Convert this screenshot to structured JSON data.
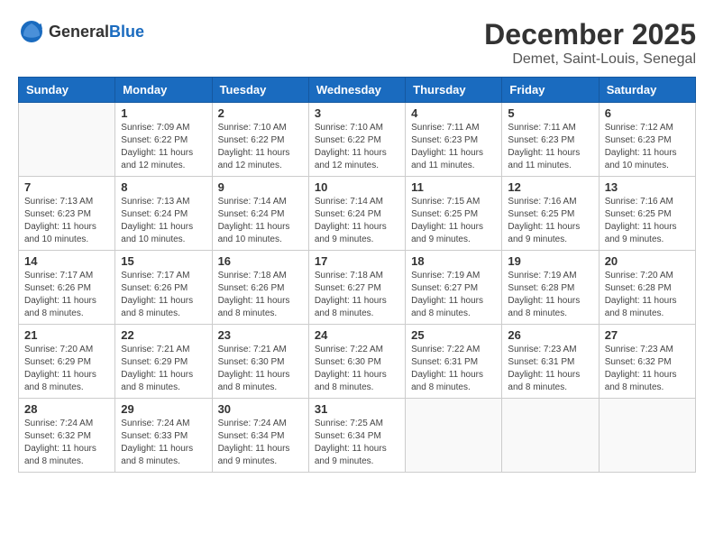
{
  "header": {
    "logo_general": "General",
    "logo_blue": "Blue",
    "month_title": "December 2025",
    "location": "Demet, Saint-Louis, Senegal"
  },
  "days_of_week": [
    "Sunday",
    "Monday",
    "Tuesday",
    "Wednesday",
    "Thursday",
    "Friday",
    "Saturday"
  ],
  "weeks": [
    [
      {
        "day": "",
        "sunrise": "",
        "sunset": "",
        "daylight": ""
      },
      {
        "day": "1",
        "sunrise": "Sunrise: 7:09 AM",
        "sunset": "Sunset: 6:22 PM",
        "daylight": "Daylight: 11 hours and 12 minutes."
      },
      {
        "day": "2",
        "sunrise": "Sunrise: 7:10 AM",
        "sunset": "Sunset: 6:22 PM",
        "daylight": "Daylight: 11 hours and 12 minutes."
      },
      {
        "day": "3",
        "sunrise": "Sunrise: 7:10 AM",
        "sunset": "Sunset: 6:22 PM",
        "daylight": "Daylight: 11 hours and 12 minutes."
      },
      {
        "day": "4",
        "sunrise": "Sunrise: 7:11 AM",
        "sunset": "Sunset: 6:23 PM",
        "daylight": "Daylight: 11 hours and 11 minutes."
      },
      {
        "day": "5",
        "sunrise": "Sunrise: 7:11 AM",
        "sunset": "Sunset: 6:23 PM",
        "daylight": "Daylight: 11 hours and 11 minutes."
      },
      {
        "day": "6",
        "sunrise": "Sunrise: 7:12 AM",
        "sunset": "Sunset: 6:23 PM",
        "daylight": "Daylight: 11 hours and 10 minutes."
      }
    ],
    [
      {
        "day": "7",
        "sunrise": "Sunrise: 7:13 AM",
        "sunset": "Sunset: 6:23 PM",
        "daylight": "Daylight: 11 hours and 10 minutes."
      },
      {
        "day": "8",
        "sunrise": "Sunrise: 7:13 AM",
        "sunset": "Sunset: 6:24 PM",
        "daylight": "Daylight: 11 hours and 10 minutes."
      },
      {
        "day": "9",
        "sunrise": "Sunrise: 7:14 AM",
        "sunset": "Sunset: 6:24 PM",
        "daylight": "Daylight: 11 hours and 10 minutes."
      },
      {
        "day": "10",
        "sunrise": "Sunrise: 7:14 AM",
        "sunset": "Sunset: 6:24 PM",
        "daylight": "Daylight: 11 hours and 9 minutes."
      },
      {
        "day": "11",
        "sunrise": "Sunrise: 7:15 AM",
        "sunset": "Sunset: 6:25 PM",
        "daylight": "Daylight: 11 hours and 9 minutes."
      },
      {
        "day": "12",
        "sunrise": "Sunrise: 7:16 AM",
        "sunset": "Sunset: 6:25 PM",
        "daylight": "Daylight: 11 hours and 9 minutes."
      },
      {
        "day": "13",
        "sunrise": "Sunrise: 7:16 AM",
        "sunset": "Sunset: 6:25 PM",
        "daylight": "Daylight: 11 hours and 9 minutes."
      }
    ],
    [
      {
        "day": "14",
        "sunrise": "Sunrise: 7:17 AM",
        "sunset": "Sunset: 6:26 PM",
        "daylight": "Daylight: 11 hours and 8 minutes."
      },
      {
        "day": "15",
        "sunrise": "Sunrise: 7:17 AM",
        "sunset": "Sunset: 6:26 PM",
        "daylight": "Daylight: 11 hours and 8 minutes."
      },
      {
        "day": "16",
        "sunrise": "Sunrise: 7:18 AM",
        "sunset": "Sunset: 6:26 PM",
        "daylight": "Daylight: 11 hours and 8 minutes."
      },
      {
        "day": "17",
        "sunrise": "Sunrise: 7:18 AM",
        "sunset": "Sunset: 6:27 PM",
        "daylight": "Daylight: 11 hours and 8 minutes."
      },
      {
        "day": "18",
        "sunrise": "Sunrise: 7:19 AM",
        "sunset": "Sunset: 6:27 PM",
        "daylight": "Daylight: 11 hours and 8 minutes."
      },
      {
        "day": "19",
        "sunrise": "Sunrise: 7:19 AM",
        "sunset": "Sunset: 6:28 PM",
        "daylight": "Daylight: 11 hours and 8 minutes."
      },
      {
        "day": "20",
        "sunrise": "Sunrise: 7:20 AM",
        "sunset": "Sunset: 6:28 PM",
        "daylight": "Daylight: 11 hours and 8 minutes."
      }
    ],
    [
      {
        "day": "21",
        "sunrise": "Sunrise: 7:20 AM",
        "sunset": "Sunset: 6:29 PM",
        "daylight": "Daylight: 11 hours and 8 minutes."
      },
      {
        "day": "22",
        "sunrise": "Sunrise: 7:21 AM",
        "sunset": "Sunset: 6:29 PM",
        "daylight": "Daylight: 11 hours and 8 minutes."
      },
      {
        "day": "23",
        "sunrise": "Sunrise: 7:21 AM",
        "sunset": "Sunset: 6:30 PM",
        "daylight": "Daylight: 11 hours and 8 minutes."
      },
      {
        "day": "24",
        "sunrise": "Sunrise: 7:22 AM",
        "sunset": "Sunset: 6:30 PM",
        "daylight": "Daylight: 11 hours and 8 minutes."
      },
      {
        "day": "25",
        "sunrise": "Sunrise: 7:22 AM",
        "sunset": "Sunset: 6:31 PM",
        "daylight": "Daylight: 11 hours and 8 minutes."
      },
      {
        "day": "26",
        "sunrise": "Sunrise: 7:23 AM",
        "sunset": "Sunset: 6:31 PM",
        "daylight": "Daylight: 11 hours and 8 minutes."
      },
      {
        "day": "27",
        "sunrise": "Sunrise: 7:23 AM",
        "sunset": "Sunset: 6:32 PM",
        "daylight": "Daylight: 11 hours and 8 minutes."
      }
    ],
    [
      {
        "day": "28",
        "sunrise": "Sunrise: 7:24 AM",
        "sunset": "Sunset: 6:32 PM",
        "daylight": "Daylight: 11 hours and 8 minutes."
      },
      {
        "day": "29",
        "sunrise": "Sunrise: 7:24 AM",
        "sunset": "Sunset: 6:33 PM",
        "daylight": "Daylight: 11 hours and 8 minutes."
      },
      {
        "day": "30",
        "sunrise": "Sunrise: 7:24 AM",
        "sunset": "Sunset: 6:34 PM",
        "daylight": "Daylight: 11 hours and 9 minutes."
      },
      {
        "day": "31",
        "sunrise": "Sunrise: 7:25 AM",
        "sunset": "Sunset: 6:34 PM",
        "daylight": "Daylight: 11 hours and 9 minutes."
      },
      {
        "day": "",
        "sunrise": "",
        "sunset": "",
        "daylight": ""
      },
      {
        "day": "",
        "sunrise": "",
        "sunset": "",
        "daylight": ""
      },
      {
        "day": "",
        "sunrise": "",
        "sunset": "",
        "daylight": ""
      }
    ]
  ]
}
